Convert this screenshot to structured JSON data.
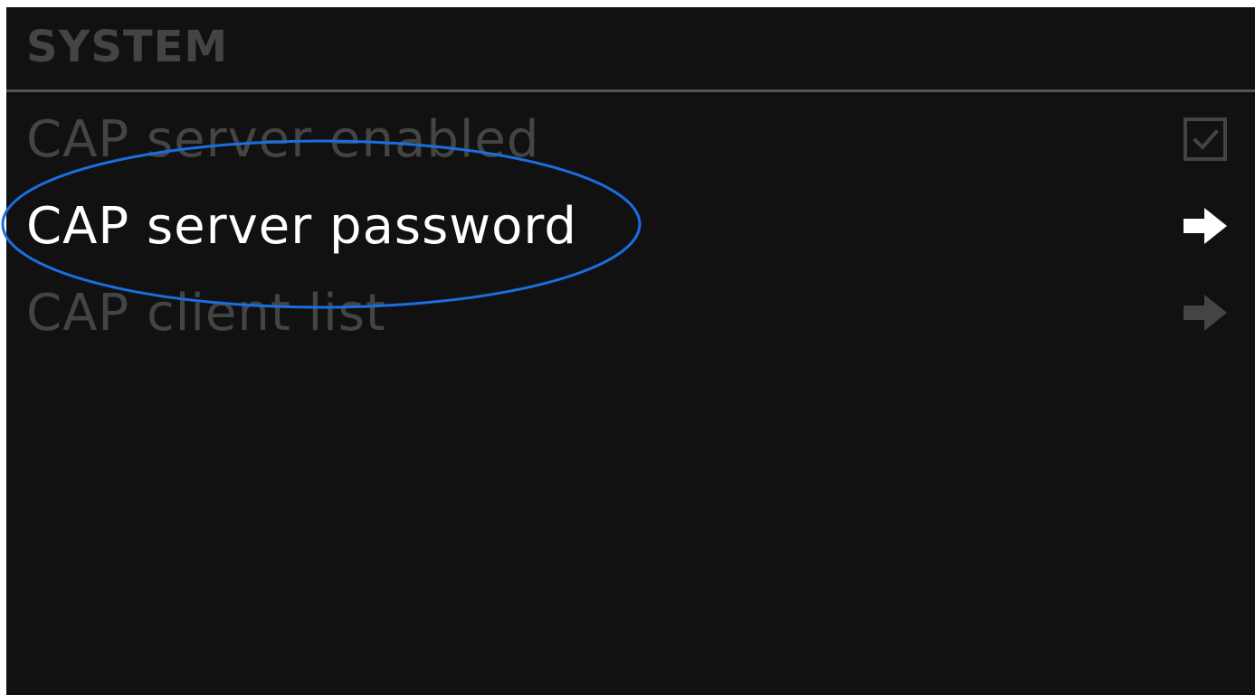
{
  "header": {
    "title": "SYSTEM"
  },
  "menu": {
    "items": [
      {
        "label": "CAP server enabled",
        "control": "checkbox",
        "checked": true,
        "active": false,
        "icon": "checkbox-checked-icon"
      },
      {
        "label": "CAP server password",
        "control": "submenu",
        "active": true,
        "icon": "arrow-right-icon"
      },
      {
        "label": "CAP client list",
        "control": "submenu",
        "active": false,
        "icon": "arrow-right-icon"
      }
    ]
  },
  "colors": {
    "background": "#111111",
    "header_text": "#444444",
    "inactive_text": "#444444",
    "active_text": "#ffffff",
    "divider": "#555555",
    "annotation_ellipse": "#1a6ee0"
  }
}
